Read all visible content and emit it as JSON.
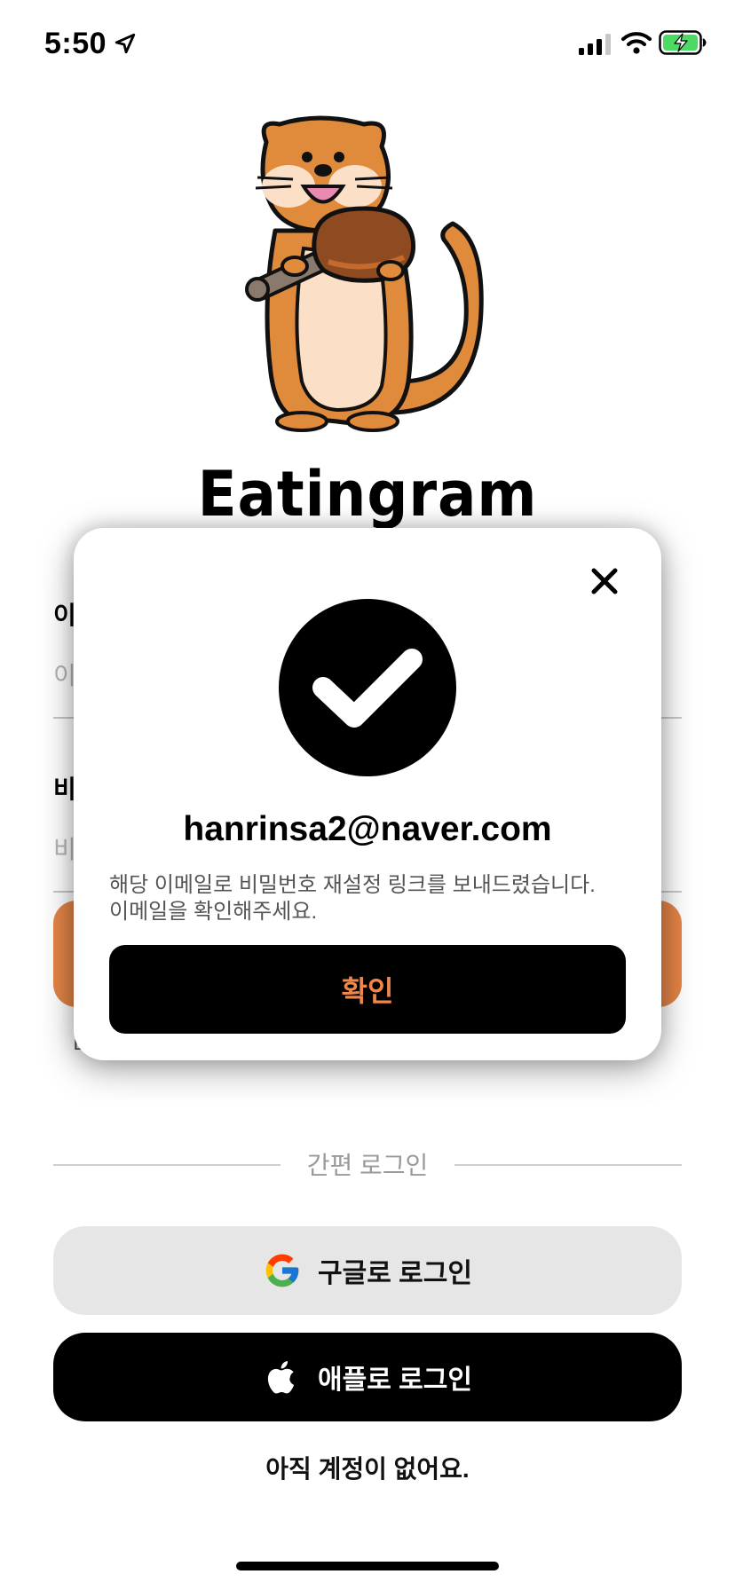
{
  "status_bar": {
    "time": "5:50",
    "icons": [
      "location-arrow-icon",
      "cellular-signal-icon",
      "wifi-icon",
      "battery-charging-icon"
    ],
    "battery_color": "#4cd964"
  },
  "header": {
    "mascot": "otter-eating-meat-logo",
    "app_title": "Eatingram"
  },
  "form": {
    "email_label": "이",
    "email_placeholder": "이",
    "password_label": "비",
    "password_placeholder": "비",
    "primary_button_color": "#e58547",
    "partially_hidden_text": "ㅁ"
  },
  "easy_login": {
    "divider_label": "간편 로그인",
    "google_label": "구글로 로그인",
    "apple_label": "애플로 로그인",
    "signup_link": "아직 계정이 없어요."
  },
  "modal": {
    "email": "hanrinsa2@naver.com",
    "message_line1": "해당 이메일로 비밀번호 재설정 링크를 보내드렸습니다.",
    "message_line2": "이메일을 확인해주세요.",
    "confirm_label": "확인",
    "confirm_text_color": "#f0874a"
  }
}
